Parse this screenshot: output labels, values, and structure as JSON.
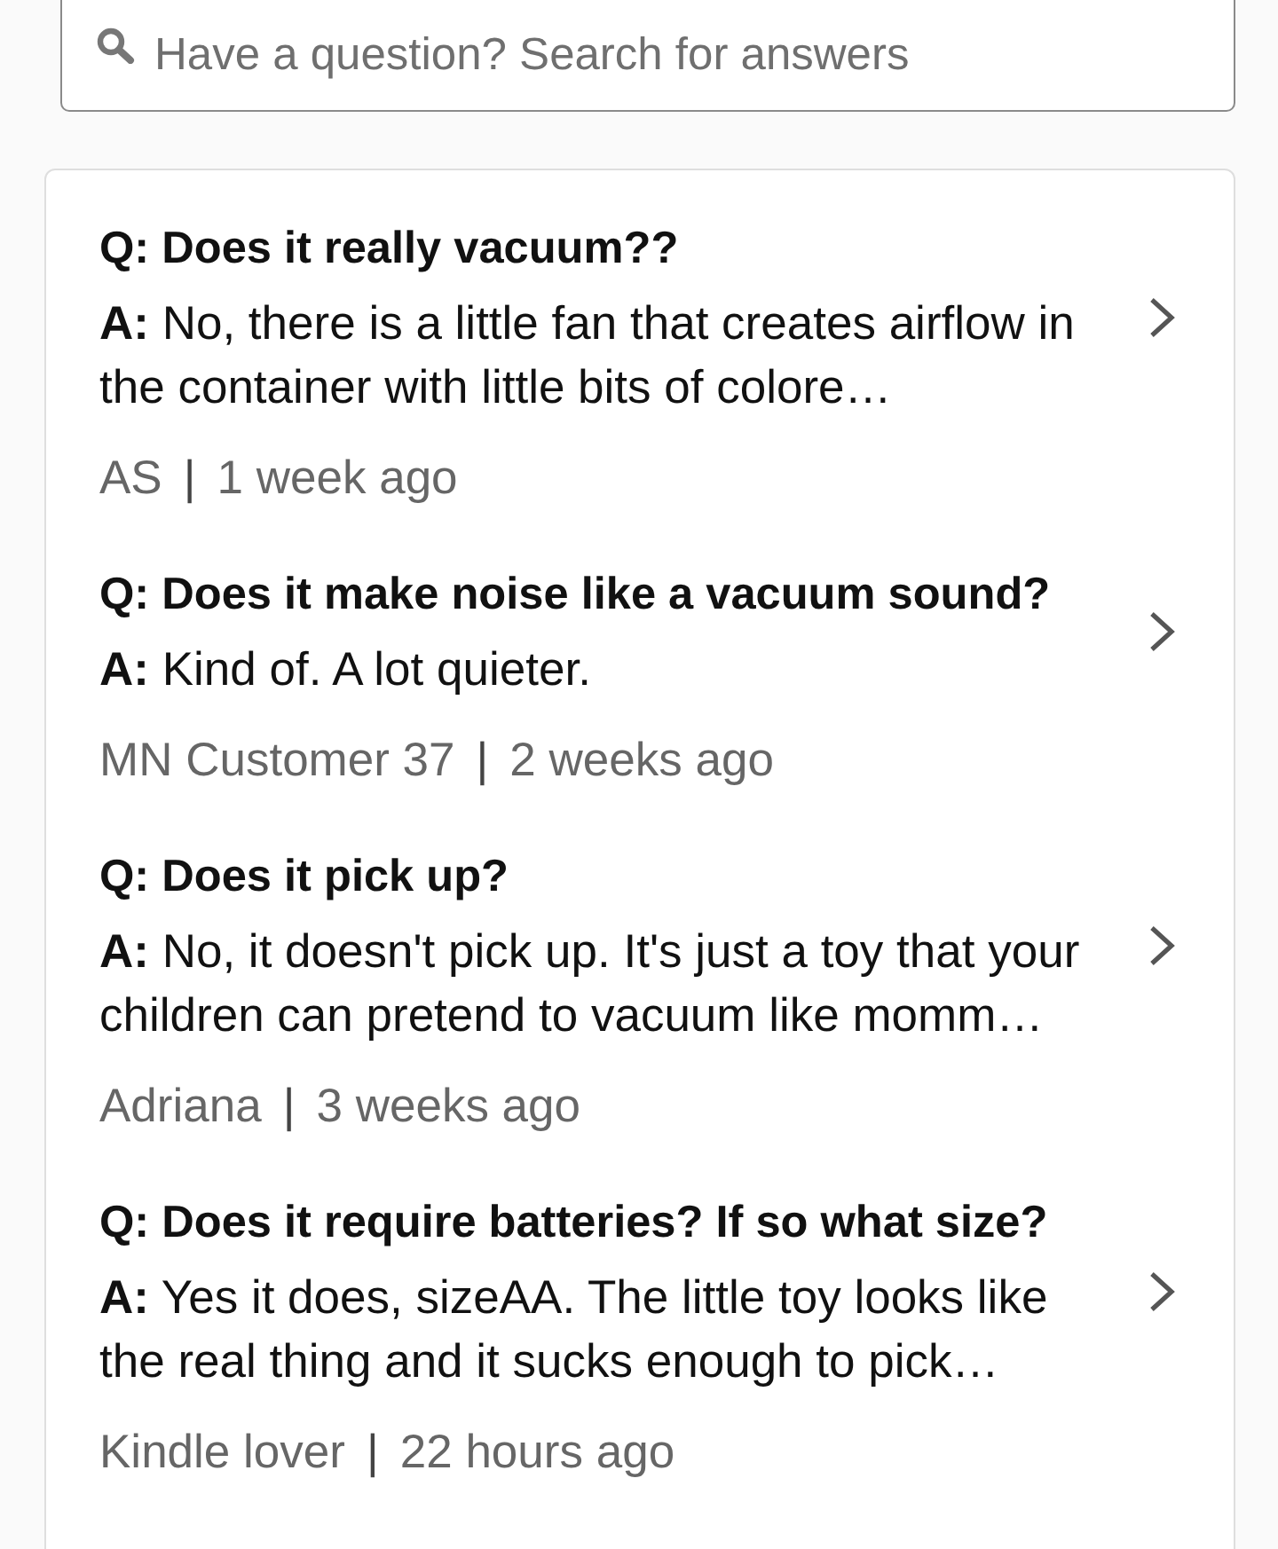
{
  "search": {
    "placeholder": "Have a question? Search for answers"
  },
  "questions": [
    {
      "question": "Q: Does it really vacuum??",
      "answer": "**A:** No, there is a little fan that creates airflow in the container with little bits of colore…",
      "author": "AS",
      "separator": "|",
      "time": "1 week ago"
    },
    {
      "question": "Q: Does it make noise like a vacuum sound?",
      "answer": "**A:** Kind of. A lot quieter.",
      "author": "MN Customer 37",
      "separator": "|",
      "time": "2 weeks ago"
    },
    {
      "question": "Q: Does it pick up?",
      "answer": "**A:** No, it doesn't pick up. It's just a toy that your children can pretend to vacuum like momm…",
      "author": "Adriana",
      "separator": "|",
      "time": "3 weeks ago"
    },
    {
      "question": "Q: Does it require batteries? If so what size?",
      "answer": "**A:** Yes it does, sizeAA. The little toy looks like the real thing and it sucks enough to pick…",
      "author": "Kindle lover",
      "separator": "|",
      "time": "22 hours ago"
    }
  ]
}
